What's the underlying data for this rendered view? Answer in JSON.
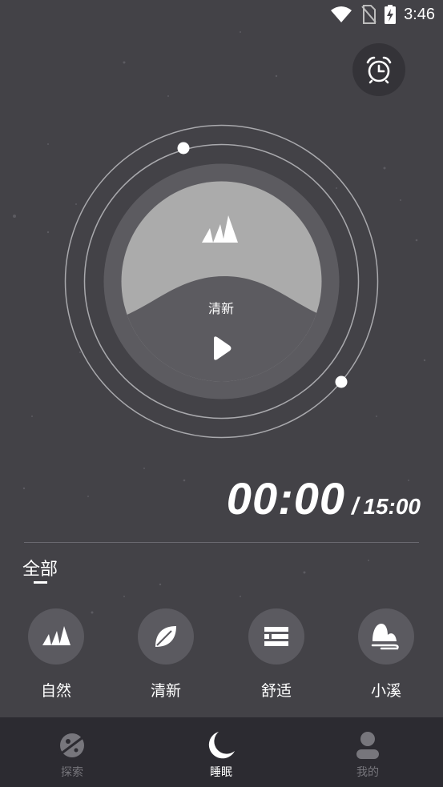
{
  "status_bar": {
    "time": "3:46"
  },
  "player": {
    "current_sound_label": "清新",
    "elapsed": "00:00",
    "separator": "/",
    "total": "15:00"
  },
  "category": {
    "active_tab": "全部"
  },
  "sounds": [
    {
      "label": "自然",
      "icon": "mountain-icon"
    },
    {
      "label": "清新",
      "icon": "leaf-icon"
    },
    {
      "label": "舒适",
      "icon": "list-icon"
    },
    {
      "label": "小溪",
      "icon": "stream-icon"
    }
  ],
  "bottom_nav": [
    {
      "label": "探索",
      "icon": "planet-icon",
      "active": false
    },
    {
      "label": "睡眠",
      "icon": "moon-icon",
      "active": true
    },
    {
      "label": "我的",
      "icon": "user-icon",
      "active": false
    }
  ],
  "colors": {
    "background": "#434247",
    "nav_background": "#2c2b31",
    "active_nav": "#ffffff",
    "inactive_nav": "#77767c",
    "dial_fill": "#ababab"
  }
}
